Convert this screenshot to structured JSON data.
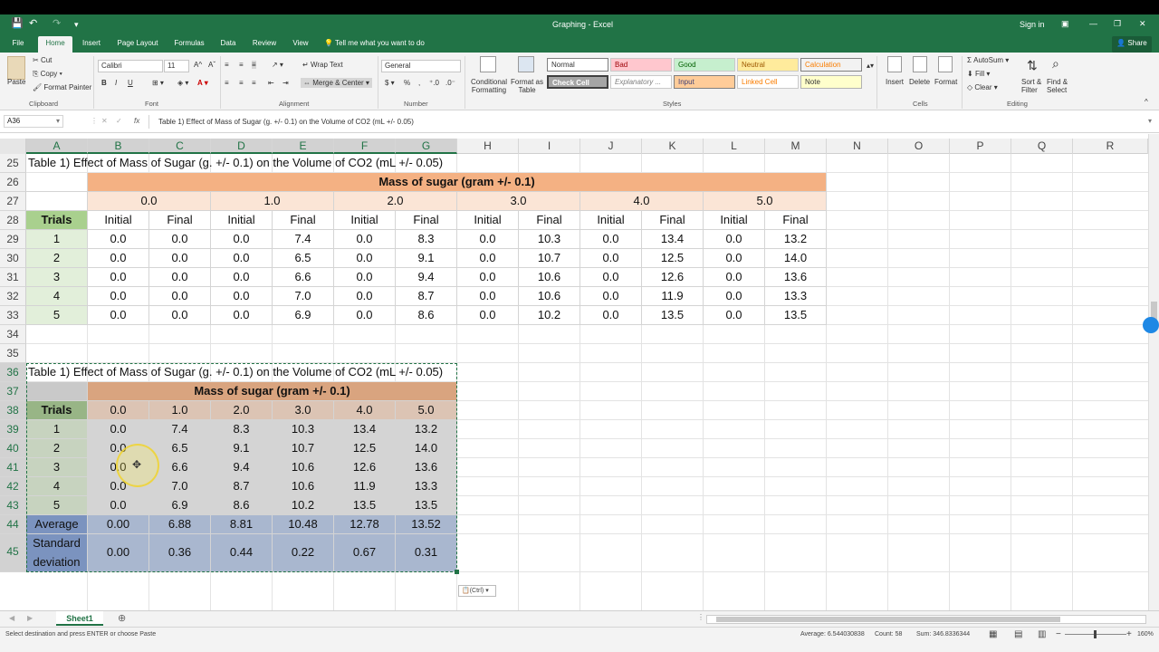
{
  "title_bar": {
    "doc_title": "Graphing - Excel",
    "sign_in": "Sign in"
  },
  "ribbon_tabs": [
    "File",
    "Home",
    "Insert",
    "Page Layout",
    "Formulas",
    "Data",
    "Review",
    "View"
  ],
  "tell_me": "Tell me what you want to do",
  "share": "Share",
  "clipboard": {
    "paste": "Paste",
    "cut": "Cut",
    "copy": "Copy",
    "format_painter": "Format Painter",
    "label": "Clipboard"
  },
  "font": {
    "name": "Calibri",
    "size": "11",
    "label": "Font"
  },
  "alignment": {
    "wrap": "Wrap Text",
    "merge": "Merge & Center",
    "label": "Alignment"
  },
  "number": {
    "format": "General",
    "label": "Number"
  },
  "styles": {
    "cond_format": "Conditional Formatting",
    "format_table": "Format as Table",
    "normal": "Normal",
    "bad": "Bad",
    "good": "Good",
    "neutral": "Neutral",
    "calculation": "Calculation",
    "check_cell": "Check Cell",
    "explanatory": "Explanatory ...",
    "input": "Input",
    "linked_cell": "Linked Cell",
    "note": "Note",
    "label": "Styles"
  },
  "cells": {
    "insert": "Insert",
    "delete": "Delete",
    "format": "Format",
    "label": "Cells"
  },
  "editing": {
    "autosum": "AutoSum",
    "fill": "Fill",
    "clear": "Clear",
    "sort": "Sort & Filter",
    "find": "Find & Select",
    "label": "Editing"
  },
  "name_box": "A36",
  "formula": "Table 1) Effect of Mass of Sugar (g. +/- 0.1) on the Volume of CO2 (mL +/- 0.05)",
  "fx": "fx",
  "columns": [
    "A",
    "B",
    "C",
    "D",
    "E",
    "F",
    "G",
    "H",
    "I",
    "J",
    "K",
    "L",
    "M",
    "N",
    "O",
    "P",
    "Q",
    "R"
  ],
  "rows": [
    "25",
    "26",
    "27",
    "28",
    "29",
    "30",
    "31",
    "32",
    "33",
    "34",
    "35",
    "36",
    "37",
    "38",
    "39",
    "40",
    "41",
    "42",
    "43",
    "44",
    "45"
  ],
  "table1": {
    "title": "Table 1) Effect of Mass of Sugar (g. +/- 0.1) on the Volume of CO2 (mL +/- 0.05)",
    "header": "Mass of sugar (gram +/- 0.1)",
    "masses": [
      "0.0",
      "1.0",
      "2.0",
      "3.0",
      "4.0",
      "5.0"
    ],
    "trials_label": "Trials",
    "initial": "Initial",
    "final": "Final",
    "data": [
      [
        "1",
        "0.0",
        "0.0",
        "0.0",
        "7.4",
        "0.0",
        "8.3",
        "0.0",
        "10.3",
        "0.0",
        "13.4",
        "0.0",
        "13.2"
      ],
      [
        "2",
        "0.0",
        "0.0",
        "0.0",
        "6.5",
        "0.0",
        "9.1",
        "0.0",
        "10.7",
        "0.0",
        "12.5",
        "0.0",
        "14.0"
      ],
      [
        "3",
        "0.0",
        "0.0",
        "0.0",
        "6.6",
        "0.0",
        "9.4",
        "0.0",
        "10.6",
        "0.0",
        "12.6",
        "0.0",
        "13.6"
      ],
      [
        "4",
        "0.0",
        "0.0",
        "0.0",
        "7.0",
        "0.0",
        "8.7",
        "0.0",
        "10.6",
        "0.0",
        "11.9",
        "0.0",
        "13.3"
      ],
      [
        "5",
        "0.0",
        "0.0",
        "0.0",
        "6.9",
        "0.0",
        "8.6",
        "0.0",
        "10.2",
        "0.0",
        "13.5",
        "0.0",
        "13.5"
      ]
    ]
  },
  "table2": {
    "title": "Table 1) Effect of Mass of Sugar (g. +/- 0.1) on the Volume of CO2 (mL +/- 0.05)",
    "header": "Mass of sugar (gram +/- 0.1)",
    "trials_label": "Trials",
    "masses": [
      "0.0",
      "1.0",
      "2.0",
      "3.0",
      "4.0",
      "5.0"
    ],
    "data": [
      [
        "1",
        "0.0",
        "7.4",
        "8.3",
        "10.3",
        "13.4",
        "13.2"
      ],
      [
        "2",
        "0.0",
        "6.5",
        "9.1",
        "10.7",
        "12.5",
        "14.0"
      ],
      [
        "3",
        "0.0",
        "6.6",
        "9.4",
        "10.6",
        "12.6",
        "13.6"
      ],
      [
        "4",
        "0.0",
        "7.0",
        "8.7",
        "10.6",
        "11.9",
        "13.3"
      ],
      [
        "5",
        "0.0",
        "6.9",
        "8.6",
        "10.2",
        "13.5",
        "13.5"
      ]
    ],
    "average_label": "Average",
    "average": [
      "0.00",
      "6.88",
      "8.81",
      "10.48",
      "12.78",
      "13.52"
    ],
    "std_label": "Standard deviation",
    "std": [
      "0.00",
      "0.36",
      "0.44",
      "0.22",
      "0.67",
      "0.31"
    ]
  },
  "paste_options": "(Ctrl)",
  "sheet_tab": "Sheet1",
  "status": {
    "message": "Select destination and press ENTER or choose Paste",
    "average": "Average: 6.544030838",
    "count": "Count: 58",
    "sum": "Sum: 346.8336344",
    "zoom": "160%"
  },
  "colors": {
    "excel_green": "#217346",
    "header_orange": "#f4b183",
    "mass_light": "#fbe5d6",
    "trials_green": "#a9d08e",
    "avg_blue": "#8ea9db"
  }
}
